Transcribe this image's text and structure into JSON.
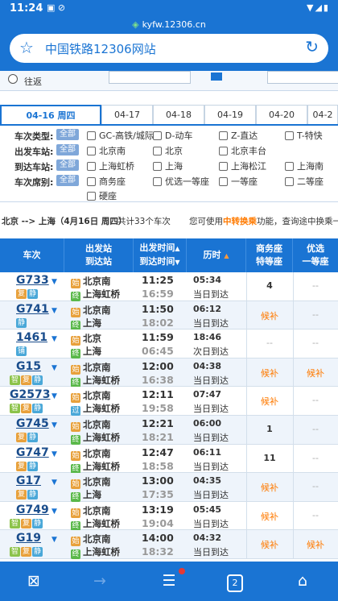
{
  "status": {
    "time": "11:24",
    "left_icons": "▣ ⊘",
    "right_icons": "▼◢▮"
  },
  "browser": {
    "domain": "kyfw.12306.cn",
    "title": "中国铁路12306网站"
  },
  "form": {
    "radio_label": "往返"
  },
  "date_tabs": [
    "04-16 周四",
    "04-17",
    "04-18",
    "04-19",
    "04-20",
    "04-2"
  ],
  "filters": {
    "all_label": "全部",
    "rows": [
      {
        "label": "车次类型:",
        "options": [
          "GC-高铁/城际",
          "D-动车",
          "Z-直达",
          "T-特快"
        ]
      },
      {
        "label": "出发车站:",
        "options": [
          "北京南",
          "北京",
          "北京丰台"
        ]
      },
      {
        "label": "到达车站:",
        "options": [
          "上海虹桥",
          "上海",
          "上海松江",
          "上海南"
        ]
      },
      {
        "label": "车次席别:",
        "options": [
          "商务座",
          "优选一等座",
          "一等座",
          "二等座"
        ]
      },
      {
        "label": "",
        "options": [
          "硬座"
        ]
      }
    ]
  },
  "summary": {
    "route": "北京 --> 上海（4月16日 周四）",
    "count": "共计33个车次",
    "hint_pre": "您可使用",
    "hint_link": "中转换乘",
    "hint_post": "功能，查询途中换乘一"
  },
  "table": {
    "headers": {
      "train": "车次",
      "stations_1": "出发站",
      "stations_2": "到达站",
      "time_1": "出发时间",
      "time_2": "到达时间",
      "duration": "历时",
      "seat1_1": "商务座",
      "seat1_2": "特等座",
      "seat2_1": "优选",
      "seat2_2": "一等座",
      "up": "▲",
      "down": "▼"
    },
    "rows": [
      {
        "no": "G733",
        "tags": [
          "复",
          "静"
        ],
        "from_mark": "始",
        "from": "北京南",
        "to_mark": "终",
        "to": "上海虹桥",
        "dep": "11:25",
        "arr": "16:59",
        "dur": "05:34",
        "arrday": "当日到达",
        "seat1": "4",
        "seat2": "--"
      },
      {
        "no": "G741",
        "tags": [
          "静"
        ],
        "from_mark": "始",
        "from": "北京南",
        "to_mark": "终",
        "to": "上海",
        "dep": "11:50",
        "arr": "18:02",
        "dur": "06:12",
        "arrday": "当日到达",
        "seat1": "候补",
        "seat2": "--"
      },
      {
        "no": "1461",
        "tags": [
          "铺"
        ],
        "from_mark": "始",
        "from": "北京",
        "to_mark": "终",
        "to": "上海",
        "dep": "11:59",
        "arr": "06:45",
        "dur": "18:46",
        "arrday": "次日到达",
        "seat1": "--",
        "seat2": "--"
      },
      {
        "no": "G15",
        "tags": [
          "智",
          "复",
          "静"
        ],
        "from_mark": "始",
        "from": "北京南",
        "to_mark": "终",
        "to": "上海虹桥",
        "dep": "12:00",
        "arr": "16:38",
        "dur": "04:38",
        "arrday": "当日到达",
        "seat1": "候补",
        "seat2": "候补"
      },
      {
        "no": "G2573",
        "tags": [
          "智",
          "复",
          "静"
        ],
        "from_mark": "始",
        "from": "北京南",
        "to_mark": "过",
        "to": "上海虹桥",
        "dep": "12:11",
        "arr": "19:58",
        "dur": "07:47",
        "arrday": "当日到达",
        "seat1": "候补",
        "seat2": "--"
      },
      {
        "no": "G745",
        "tags": [
          "复",
          "静"
        ],
        "from_mark": "始",
        "from": "北京南",
        "to_mark": "终",
        "to": "上海虹桥",
        "dep": "12:21",
        "arr": "18:21",
        "dur": "06:00",
        "arrday": "当日到达",
        "seat1": "1",
        "seat2": "--"
      },
      {
        "no": "G747",
        "tags": [
          "复",
          "静"
        ],
        "from_mark": "始",
        "from": "北京南",
        "to_mark": "终",
        "to": "上海虹桥",
        "dep": "12:47",
        "arr": "18:58",
        "dur": "06:11",
        "arrday": "当日到达",
        "seat1": "11",
        "seat2": "--"
      },
      {
        "no": "G17",
        "tags": [
          "复",
          "静"
        ],
        "from_mark": "始",
        "from": "北京南",
        "to_mark": "终",
        "to": "上海",
        "dep": "13:00",
        "arr": "17:35",
        "dur": "04:35",
        "arrday": "当日到达",
        "seat1": "候补",
        "seat2": "--"
      },
      {
        "no": "G749",
        "tags": [
          "智",
          "复",
          "静"
        ],
        "from_mark": "始",
        "from": "北京南",
        "to_mark": "终",
        "to": "上海虹桥",
        "dep": "13:19",
        "arr": "19:04",
        "dur": "05:45",
        "arrday": "当日到达",
        "seat1": "候补",
        "seat2": "--"
      },
      {
        "no": "G19",
        "tags": [
          "智",
          "复",
          "静"
        ],
        "from_mark": "始",
        "from": "北京南",
        "to_mark": "终",
        "to": "上海虹桥",
        "dep": "14:00",
        "arr": "18:32",
        "dur": "04:32",
        "arrday": "当日到达",
        "seat1": "候补",
        "seat2": "候补"
      }
    ]
  },
  "nav": {
    "close_tabs": "⊠",
    "forward": "→",
    "menu": "☰",
    "tabs_count": "2",
    "home": "⌂"
  },
  "colors": {
    "primary": "#1a74d3",
    "accent": "#ff7a00",
    "soldout": "#aaaaaa"
  }
}
